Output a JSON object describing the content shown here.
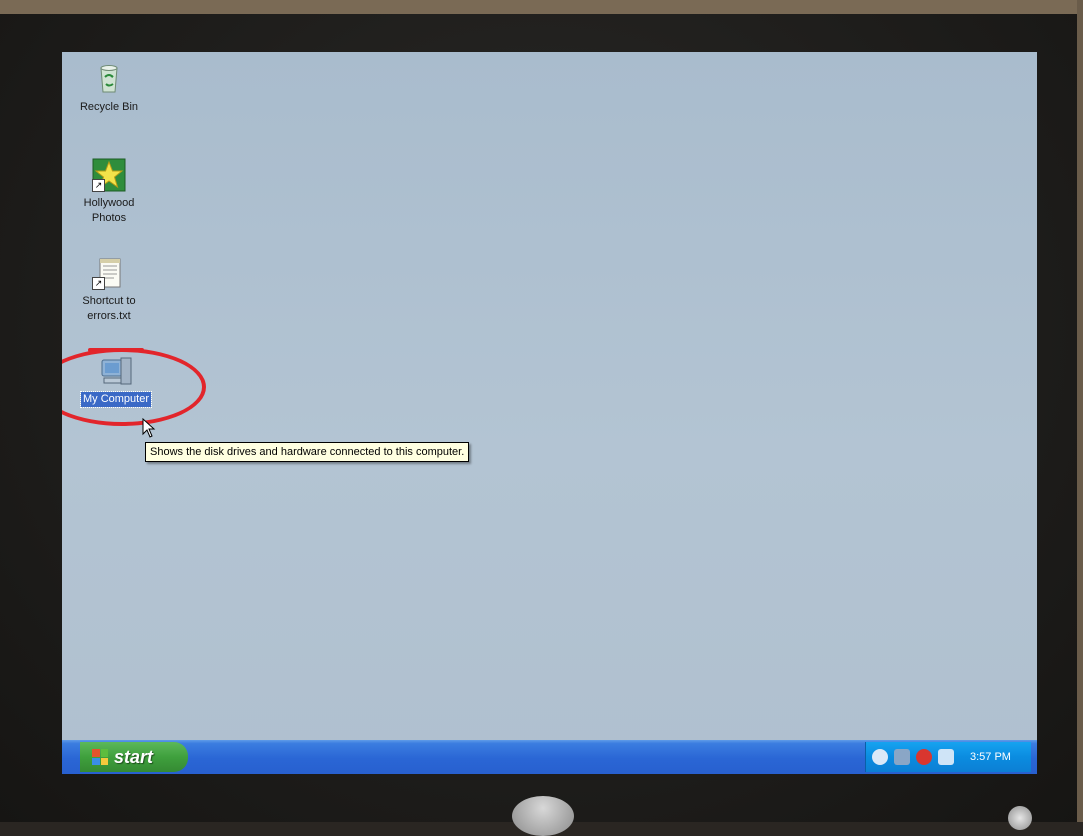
{
  "desktop": {
    "icons": [
      {
        "label": "Recycle Bin"
      },
      {
        "label": "Hollywood Photos"
      },
      {
        "label": "Shortcut to errors.txt"
      },
      {
        "label": "My Computer"
      }
    ],
    "tooltip": "Shows the disk drives and hardware connected to this computer."
  },
  "taskbar": {
    "start_label": "start",
    "clock": "3:57 PM"
  },
  "colors": {
    "desktop_bg": "#b3c4d3",
    "taskbar_blue": "#2a66d5",
    "start_green": "#3fa03d",
    "annotation_red": "#e2252b"
  }
}
